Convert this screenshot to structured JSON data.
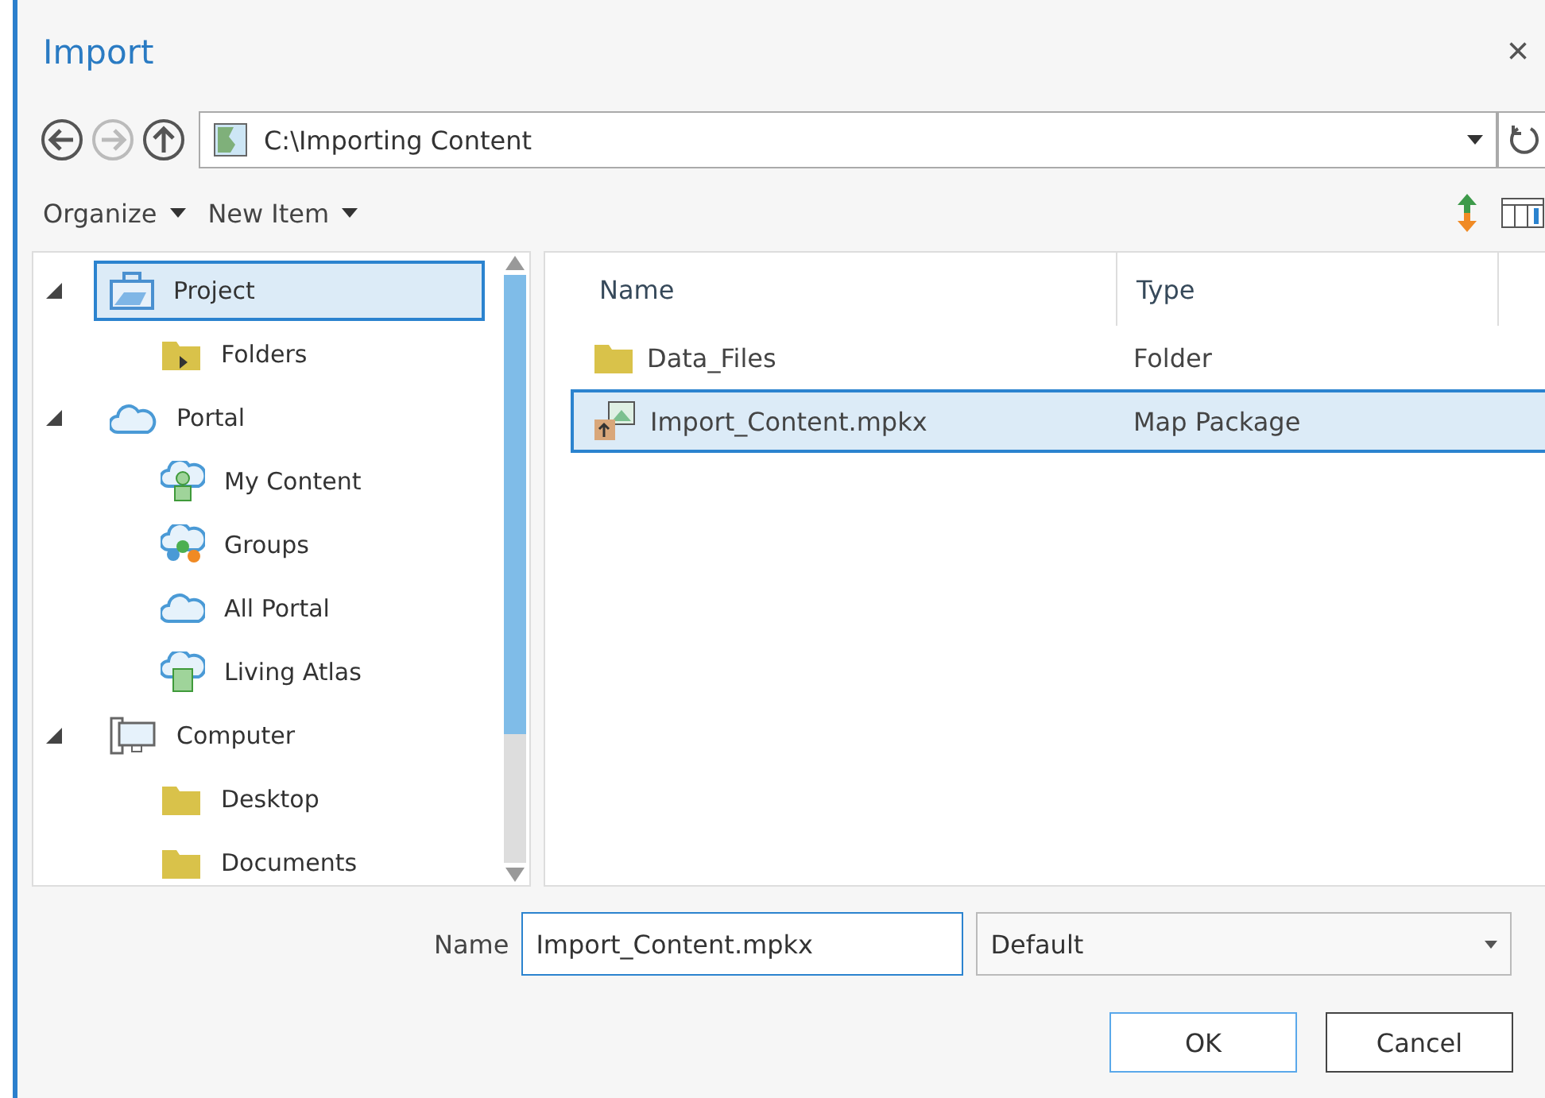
{
  "window": {
    "title": "Import",
    "close": "×"
  },
  "path": {
    "value": "C:\\Importing Content"
  },
  "toolbar": [
    "Organize",
    "New Item"
  ],
  "tree": [
    {
      "label": "Project",
      "kind": "project",
      "selected": true,
      "expanded": true,
      "children": [
        {
          "label": "Folders",
          "kind": "folders",
          "selected": false
        }
      ]
    },
    {
      "label": "Portal",
      "kind": "portal",
      "selected": false,
      "expanded": true,
      "children": [
        {
          "label": "My Content",
          "kind": "mycontent",
          "selected": false
        },
        {
          "label": "Groups",
          "kind": "groups",
          "selected": false
        },
        {
          "label": "All Portal",
          "kind": "cloud",
          "selected": false
        },
        {
          "label": "Living Atlas",
          "kind": "atlas",
          "selected": false
        }
      ]
    },
    {
      "label": "Computer",
      "kind": "computer",
      "selected": false,
      "expanded": true,
      "children": [
        {
          "label": "Desktop",
          "kind": "folder",
          "selected": false
        },
        {
          "label": "Documents",
          "kind": "folder",
          "selected": false
        }
      ]
    }
  ],
  "table": {
    "columns": [
      "Name",
      "Type"
    ],
    "rows": [
      {
        "name": "Data_Files",
        "type": "Folder",
        "kind": "folder",
        "selected": false
      },
      {
        "name": "Import_Content.mpkx",
        "type": "Map Package",
        "kind": "package",
        "selected": true
      }
    ]
  },
  "name_field": {
    "label": "Name",
    "value": "Import_Content.mpkx"
  },
  "filter": {
    "value": "Default"
  },
  "buttons": [
    {
      "label": "OK",
      "kind": "primary"
    },
    {
      "label": "Cancel",
      "kind": "secondary"
    }
  ]
}
